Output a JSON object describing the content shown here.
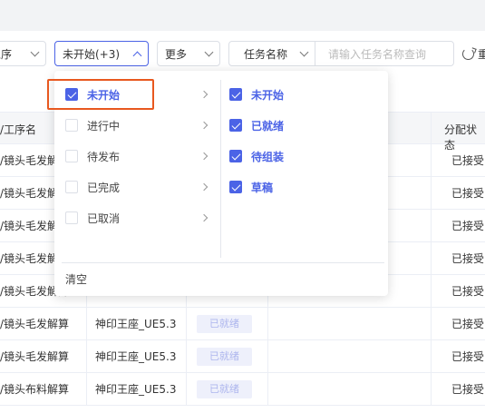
{
  "toolbar": {
    "process_label": "工序",
    "status_filter_label": "未开始(+3)",
    "more_label": "更多",
    "task_field_label": "任务名称",
    "task_input_placeholder": "请输入任务名称查询",
    "reset_label": "重"
  },
  "status_menu": {
    "primary": [
      {
        "label": "未开始",
        "checked": true
      },
      {
        "label": "进行中",
        "checked": false
      },
      {
        "label": "待发布",
        "checked": false
      },
      {
        "label": "已完成",
        "checked": false
      },
      {
        "label": "已取消",
        "checked": false
      }
    ],
    "secondary": [
      {
        "label": "未开始",
        "checked": true
      },
      {
        "label": "已就绪",
        "checked": true
      },
      {
        "label": "待组装",
        "checked": true
      },
      {
        "label": "草稿",
        "checked": true
      }
    ],
    "clear_label": "清空"
  },
  "table": {
    "headers": {
      "name": "/工序名",
      "assign": "分配状态"
    },
    "rows": [
      {
        "name": "/镜头毛发解算",
        "project": "",
        "status": "",
        "assign": "已接受"
      },
      {
        "name": "/镜头毛发解算",
        "project": "",
        "status": "",
        "assign": "已接受"
      },
      {
        "name": "/镜头毛发解算",
        "project": "",
        "status": "",
        "assign": "已接受"
      },
      {
        "name": "/镜头毛发解算",
        "project": "",
        "status": "",
        "assign": "已接受"
      },
      {
        "name": "/镜头毛发解算",
        "project": "",
        "status": "",
        "assign": "已接受"
      },
      {
        "name": "/镜头毛发解算",
        "project": "神印王座_UE5.3",
        "status": "已就绪",
        "assign": "已接受"
      },
      {
        "name": "/镜头毛发解算",
        "project": "神印王座_UE5.3",
        "status": "已就绪",
        "assign": "已接受"
      },
      {
        "name": "/镜头布料解算",
        "project": "神印王座_UE5.3",
        "status": "已就绪",
        "assign": "已接受"
      }
    ]
  },
  "colors": {
    "accent": "#4b63e6",
    "highlight": "#e8581f"
  }
}
